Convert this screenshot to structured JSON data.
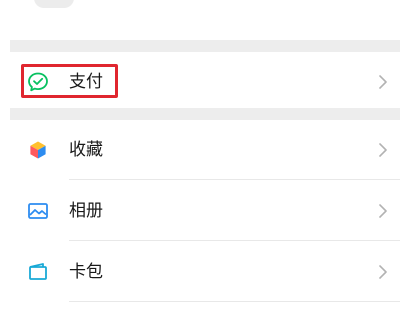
{
  "menu": {
    "items": [
      {
        "label": "支付",
        "icon": "wechat-pay-icon"
      },
      {
        "label": "收藏",
        "icon": "favorites-cube-icon"
      },
      {
        "label": "相册",
        "icon": "album-photo-icon"
      },
      {
        "label": "卡包",
        "icon": "card-wallet-icon"
      }
    ]
  },
  "colors": {
    "pay_green": "#07c160",
    "highlight_red": "#e0262f",
    "album_blue": "#2d8cf0",
    "card_cyan": "#19a9d6",
    "chevron_gray": "#b2b2b2",
    "separator_gray": "#ededed"
  }
}
